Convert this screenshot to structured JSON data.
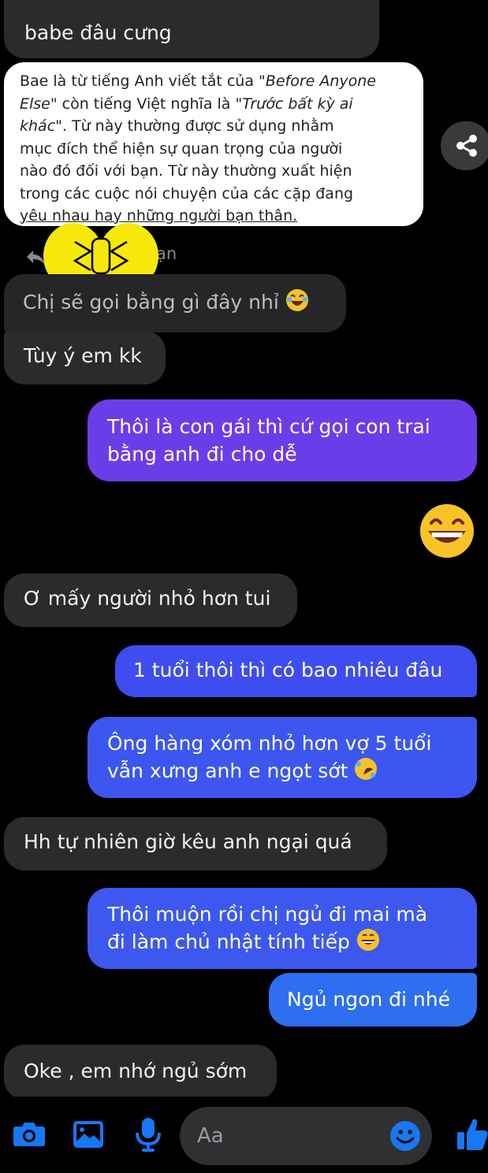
{
  "messages": {
    "m1": "babe đâu cưng",
    "wiki": {
      "line1_a": "Bae là từ tiếng Anh viết tắt của \"",
      "line1_em": "Before Anyone",
      "line2_em": "Else",
      "line2_b": "\" còn tiếng Việt nghĩa là \"",
      "line2_em2": "Trước bất kỳ ai",
      "line3_em": "khác",
      "line3_b": "\". Từ này thường được sử dụng nhằm",
      "line4": "mục đích thể hiện sự quan trọng của người",
      "line5": "nào đó đối với bạn. Từ này thường xuất hiện",
      "line6": "trong các cuộc nói chuyện của các cặp đang",
      "line7": "yêu nhau hay những người bạn thân."
    },
    "reply_label_tail": "ạn",
    "m2": "Chị sẽ gọi bằng gì đây nhỉ",
    "m3": "Tùy ý em kk",
    "m4_line1": "Thôi là con gái thì cứ gọi con trai",
    "m4_line2": "bằng anh đi cho dễ",
    "m5": "Ơ mấy người nhỏ hơn tui",
    "m6": "1 tuổi thôi thì có bao nhiêu đâu",
    "m7_line1": "Ông hàng xóm nhỏ hơn vợ 5 tuổi",
    "m7_line2": "vẫn xưng anh e ngọt sớt",
    "m8": "Hh tự nhiên giờ kêu anh ngại quá",
    "m9_line1": "Thôi muộn rồi chị ngủ đi mai mà",
    "m9_line2": "đi làm chủ nhật tính tiếp",
    "m10": "Ngủ ngon đi nhé",
    "m11": "Oke , em nhớ ngủ sớm"
  },
  "composer": {
    "placeholder": "Aa",
    "icons": [
      "camera-icon",
      "image-icon",
      "microphone-icon",
      "emoji-icon",
      "thumbs-up-icon"
    ]
  },
  "colors": {
    "incoming": "#2b2b2d",
    "outgoing_purple": "#6b3de8",
    "outgoing_blue": "#3a5cf0",
    "accent": "#1877f2"
  }
}
